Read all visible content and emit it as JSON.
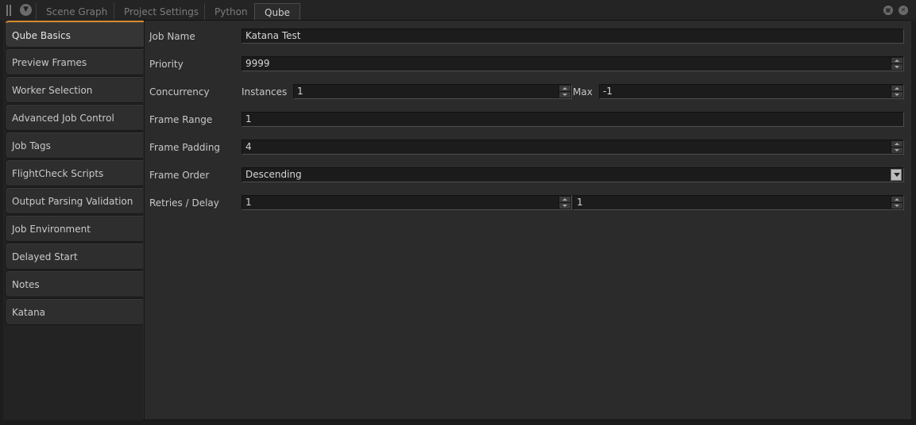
{
  "tabs": [
    "Scene Graph",
    "Project Settings",
    "Python",
    "Qube"
  ],
  "active_tab": "Qube",
  "sidebar": {
    "items": [
      {
        "label": "Qube Basics"
      },
      {
        "label": "Preview Frames"
      },
      {
        "label": "Worker Selection"
      },
      {
        "label": "Advanced Job Control"
      },
      {
        "label": "Job Tags"
      },
      {
        "label": "FlightCheck Scripts"
      },
      {
        "label": "Output Parsing Validation"
      },
      {
        "label": "Job Environment"
      },
      {
        "label": "Delayed Start"
      },
      {
        "label": "Notes"
      },
      {
        "label": "Katana"
      }
    ],
    "active": "Qube Basics"
  },
  "form": {
    "job_name": {
      "label": "Job Name",
      "value": "Katana Test"
    },
    "priority": {
      "label": "Priority",
      "value": "9999"
    },
    "concurrency": {
      "label": "Concurrency",
      "instances_label": "Instances",
      "instances_value": "1",
      "max_label": "Max",
      "max_value": "-1"
    },
    "frame_range": {
      "label": "Frame Range",
      "value": "1"
    },
    "frame_padding": {
      "label": "Frame Padding",
      "value": "4"
    },
    "frame_order": {
      "label": "Frame Order",
      "value": "Descending"
    },
    "retries_delay": {
      "label": "Retries / Delay",
      "retries_value": "1",
      "delay_value": "1"
    }
  },
  "icons": {
    "panel_menu": "chevron-down-icon",
    "float_window": "float-icon",
    "close_window": "close-icon"
  }
}
